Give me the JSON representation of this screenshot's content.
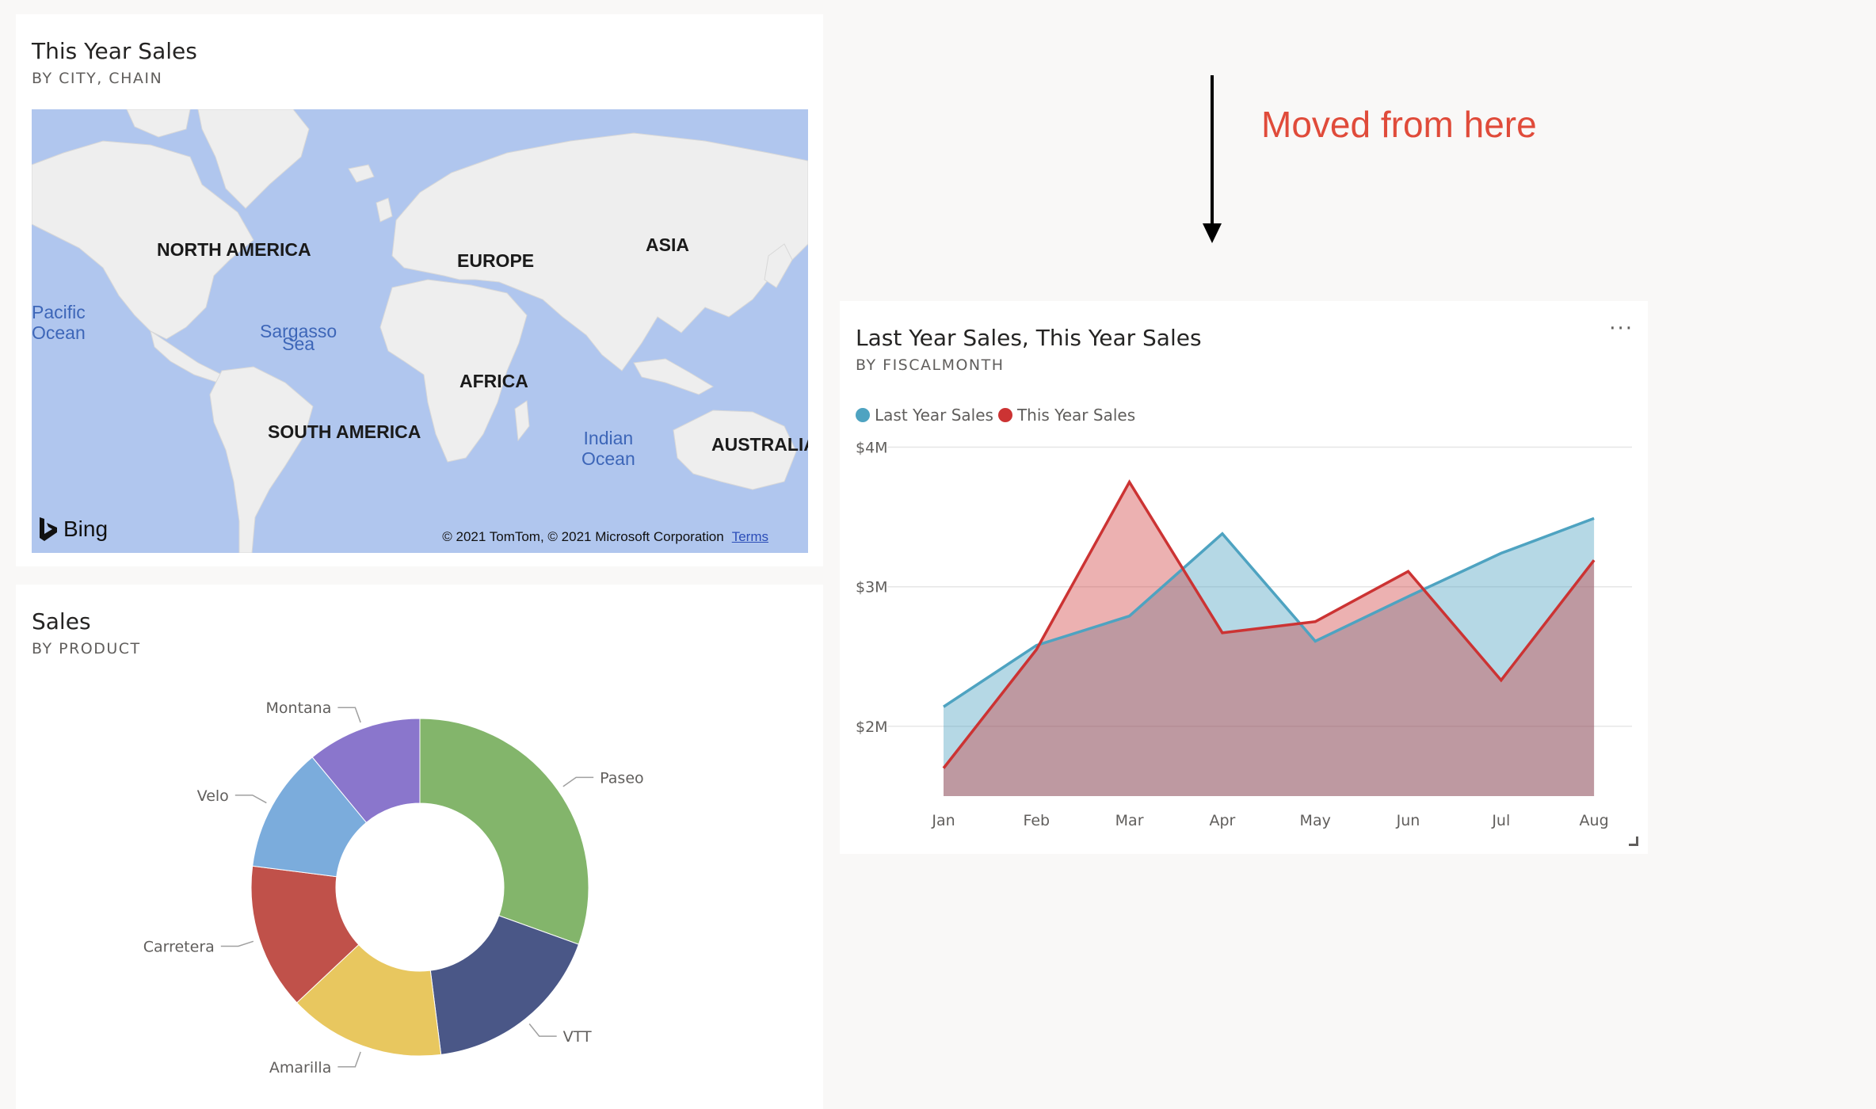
{
  "map_tile": {
    "title": "This Year Sales",
    "subtitle": "BY CITY, CHAIN",
    "labels": {
      "north_america": "NORTH AMERICA",
      "europe": "EUROPE",
      "asia": "ASIA",
      "africa": "AFRICA",
      "south_america": "SOUTH AMERICA",
      "australia": "AUSTRALIA",
      "pacific_ocean_1": "Pacific",
      "pacific_ocean_2": "Ocean",
      "sargasso_1": "Sargasso",
      "sargasso_2": "Sea",
      "indian_ocean_1": "Indian",
      "indian_ocean_2": "Ocean"
    },
    "bing_label": "Bing",
    "copyright": "© 2021 TomTom, © 2021 Microsoft Corporation",
    "terms_label": "Terms",
    "colors": {
      "water": "#b0c6ee",
      "land": "#eeeeee"
    }
  },
  "donut_tile": {
    "title": "Sales",
    "subtitle": "BY PRODUCT"
  },
  "area_tile": {
    "title": "Last Year Sales, This Year Sales",
    "subtitle": "BY FISCALMONTH",
    "more_options": "···"
  },
  "annotation": {
    "text": "Moved from here",
    "color": "#e04b3a"
  },
  "chart_data": [
    {
      "type": "pie",
      "title": "Sales",
      "subtitle": "BY PRODUCT",
      "categories": [
        "Paseo",
        "VTT",
        "Amarilla",
        "Carretera",
        "Velo",
        "Montana"
      ],
      "values": [
        30.5,
        17.5,
        15,
        14,
        12,
        11
      ],
      "colors": [
        "#83b56b",
        "#4a5787",
        "#e8c75f",
        "#c0514a",
        "#7bacdc",
        "#8a76cc"
      ],
      "donut": true
    },
    {
      "type": "area",
      "title": "Last Year Sales, This Year Sales",
      "subtitle": "BY FISCALMONTH",
      "categories": [
        "Jan",
        "Feb",
        "Mar",
        "Apr",
        "May",
        "Jun",
        "Jul",
        "Aug"
      ],
      "series": [
        {
          "name": "Last Year Sales",
          "color": "#4ea3c1",
          "values": [
            2.14,
            2.58,
            2.79,
            3.38,
            2.61,
            2.93,
            3.24,
            3.49
          ]
        },
        {
          "name": "This Year Sales",
          "color": "#cc3333",
          "values": [
            1.7,
            2.55,
            3.75,
            2.67,
            2.75,
            3.11,
            2.33,
            3.19
          ]
        }
      ],
      "y_ticks": [
        "$4M",
        "$3M",
        "$2M"
      ],
      "y_tick_values": [
        4,
        3,
        2
      ],
      "ylim": [
        1.5,
        4
      ],
      "grid": true,
      "legend": "top-left"
    }
  ]
}
